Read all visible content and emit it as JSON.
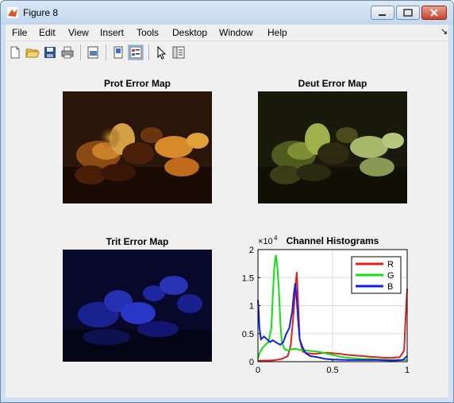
{
  "window": {
    "title": "Figure 8"
  },
  "menu": [
    "File",
    "Edit",
    "View",
    "Insert",
    "Tools",
    "Desktop",
    "Window",
    "Help"
  ],
  "toolbar_icons": [
    "new-file-icon",
    "open-folder-icon",
    "save-icon",
    "print-icon",
    "print-preview-icon",
    "hide-plot-tools-icon",
    "show-plot-tools-icon",
    "pointer-icon",
    "property-editor-icon"
  ],
  "axes": {
    "prot_title": "Prot Error Map",
    "deut_title": "Deut Error Map",
    "trit_title": "Trit Error Map",
    "hist_title": "Channel Histograms"
  },
  "chart_data": {
    "type": "line",
    "title": "Channel Histograms",
    "exponent_label": "×10",
    "exponent_power": "4",
    "xlim": [
      0,
      1
    ],
    "ylim": [
      0,
      2
    ],
    "xticks": [
      "0",
      "0.5",
      "1"
    ],
    "yticks": [
      "0",
      "0.5",
      "1",
      "1.5",
      "2"
    ],
    "grid": true,
    "legend_position": "top-right",
    "series": [
      {
        "name": "R",
        "color": "#e02020",
        "x": [
          0.0,
          0.02,
          0.05,
          0.08,
          0.12,
          0.16,
          0.2,
          0.22,
          0.24,
          0.25,
          0.26,
          0.27,
          0.28,
          0.3,
          0.33,
          0.38,
          0.42,
          0.46,
          0.5,
          0.55,
          0.6,
          0.65,
          0.7,
          0.75,
          0.8,
          0.85,
          0.9,
          0.95,
          0.98,
          0.99,
          1.0
        ],
        "y": [
          0.02,
          0.02,
          0.02,
          0.02,
          0.03,
          0.05,
          0.1,
          0.3,
          0.9,
          1.3,
          1.6,
          1.0,
          0.4,
          0.18,
          0.15,
          0.14,
          0.15,
          0.16,
          0.15,
          0.14,
          0.12,
          0.11,
          0.1,
          0.09,
          0.08,
          0.07,
          0.07,
          0.08,
          0.2,
          0.8,
          1.3
        ]
      },
      {
        "name": "G",
        "color": "#10e010",
        "x": [
          0.0,
          0.01,
          0.03,
          0.05,
          0.07,
          0.09,
          0.1,
          0.11,
          0.12,
          0.13,
          0.14,
          0.15,
          0.16,
          0.18,
          0.2,
          0.22,
          0.25,
          0.28,
          0.32,
          0.36,
          0.4,
          0.45,
          0.5,
          0.55,
          0.6,
          0.65,
          0.7,
          0.75,
          0.8,
          0.9,
          1.0
        ],
        "y": [
          0.05,
          0.15,
          0.25,
          0.3,
          0.35,
          0.6,
          1.2,
          1.7,
          1.9,
          1.7,
          1.3,
          0.7,
          0.35,
          0.22,
          0.2,
          0.22,
          0.23,
          0.21,
          0.2,
          0.19,
          0.18,
          0.15,
          0.12,
          0.09,
          0.07,
          0.06,
          0.05,
          0.05,
          0.04,
          0.03,
          0.03
        ]
      },
      {
        "name": "B",
        "color": "#1020e0",
        "x": [
          0.0,
          0.005,
          0.01,
          0.02,
          0.04,
          0.06,
          0.08,
          0.1,
          0.13,
          0.15,
          0.17,
          0.19,
          0.21,
          0.23,
          0.24,
          0.25,
          0.26,
          0.27,
          0.28,
          0.3,
          0.32,
          0.35,
          0.4,
          0.45,
          0.5,
          0.6,
          0.7,
          0.8,
          0.9,
          0.97,
          1.0
        ],
        "y": [
          1.1,
          0.9,
          0.6,
          0.4,
          0.45,
          0.4,
          0.35,
          0.38,
          0.33,
          0.3,
          0.35,
          0.5,
          0.6,
          0.9,
          1.2,
          1.4,
          1.1,
          0.7,
          0.4,
          0.25,
          0.15,
          0.1,
          0.08,
          0.05,
          0.04,
          0.03,
          0.03,
          0.03,
          0.02,
          0.03,
          0.1
        ]
      }
    ]
  }
}
